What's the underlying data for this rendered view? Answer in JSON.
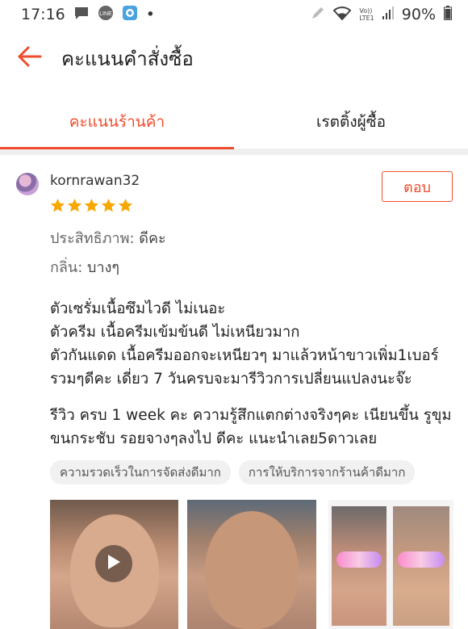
{
  "statusbar": {
    "time": "17:16",
    "dot": "•",
    "lte_top": "Vo))",
    "lte_bottom": "LTE1",
    "battery": "90%",
    "icons": [
      "message-icon",
      "line-icon",
      "camera-app-icon",
      "pen-icon",
      "wifi-icon",
      "signal-icon",
      "battery-icon"
    ]
  },
  "appbar": {
    "title": "คะแนนคำสั่งซื้อ",
    "back_icon": "arrow-left-icon"
  },
  "tabs": [
    {
      "label": "คะแนนร้านค้า",
      "active": true
    },
    {
      "label": "เรตติ้งผู้ซื้อ",
      "active": false
    }
  ],
  "review": {
    "username": "kornrawan32",
    "reply_label": "ตอบ",
    "rating": 5,
    "attributes": [
      {
        "key": "ประสิทธิภาพ:",
        "value": "ดีคะ"
      },
      {
        "key": "กลิ่น:",
        "value": "บางๆ"
      }
    ],
    "paragraph1": [
      "ตัวเซรั่มเนื้อซึมไวดี ไม่เนอะ",
      "ตัวครีม เนื้อครีมเข้มข้นดี ไม่เหนียวมาก",
      "ตัวกันแดด เนื้อครีมออกจะเหนียวๆ มาแล้วหน้าขาวเพิ่ม1เบอร์",
      "รวมๆดีคะ เดี่ยว 7 วันครบจะมารีวิวการเปลี่ยนแปลงนะจ๊ะ"
    ],
    "paragraph2": [
      "รีวิว ครบ 1 week คะ ความรู้สึกแตกต่างจริงๆคะ เนียนขึ้น รูขุม",
      "ขนกระชับ รอยจางๆลงไป ดีคะ แนะนำเลย5ดาวเลย"
    ],
    "tags": [
      "ความรวดเร็วในการจัดส่งดีมาก",
      "การให้บริการจากร้านค้าดีมาก"
    ],
    "media": [
      "video-thumbnail",
      "photo",
      "before-after-photo"
    ]
  },
  "colors": {
    "accent": "#ee4d2d",
    "star": "#f6a700"
  }
}
